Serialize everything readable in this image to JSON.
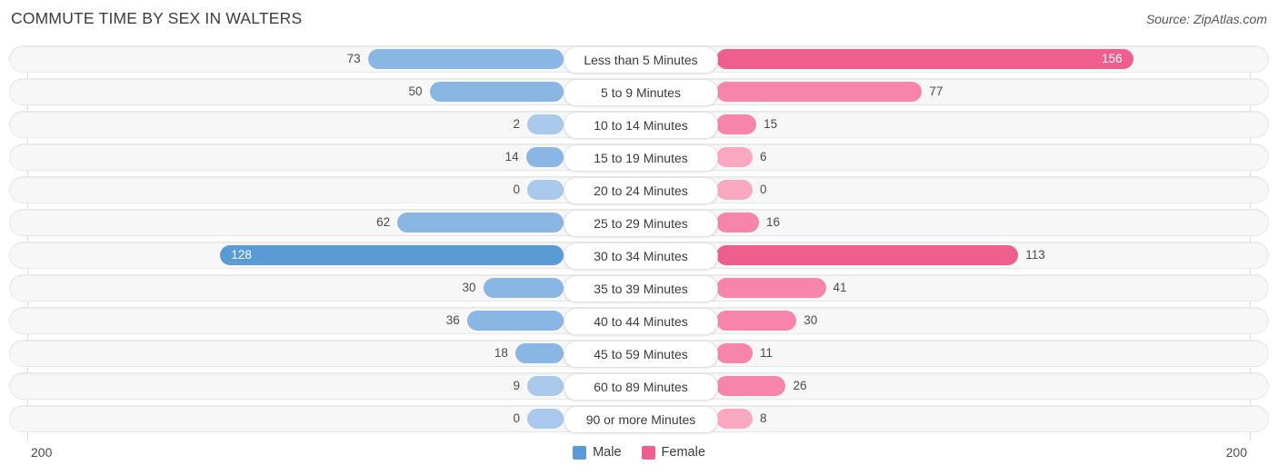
{
  "header": {
    "title": "COMMUTE TIME BY SEX IN WALTERS",
    "source": "Source: ZipAtlas.com"
  },
  "axis": {
    "left_tick": "200",
    "right_tick": "200"
  },
  "legend": {
    "items": [
      {
        "label": "Male",
        "color": "#5b9bd5"
      },
      {
        "label": "Female",
        "color": "#ef5f8d"
      }
    ]
  },
  "colors": {
    "male_strong": "#5b9bd5",
    "male_light": "#a8c8ec",
    "female_strong": "#ef5f8d",
    "female_light": "#f9a8c0",
    "track": "#f7f7f7",
    "track_border": "#e8e8e8",
    "axis_line": "#dcdcdc"
  },
  "chart_data": {
    "type": "bar",
    "title": "COMMUTE TIME BY SEX IN WALTERS",
    "orientation": "horizontal-diverging",
    "xlabel": "",
    "ylabel": "",
    "xlim": [
      -200,
      200
    ],
    "axis_max": 200,
    "grid": false,
    "legend_position": "bottom-center",
    "categories": [
      "Less than 5 Minutes",
      "5 to 9 Minutes",
      "10 to 14 Minutes",
      "15 to 19 Minutes",
      "20 to 24 Minutes",
      "25 to 29 Minutes",
      "30 to 34 Minutes",
      "35 to 39 Minutes",
      "40 to 44 Minutes",
      "45 to 59 Minutes",
      "60 to 89 Minutes",
      "90 or more Minutes"
    ],
    "series": [
      {
        "name": "Male",
        "color": "#5b9bd5",
        "values": [
          73,
          50,
          2,
          14,
          0,
          62,
          128,
          30,
          36,
          18,
          9,
          0
        ]
      },
      {
        "name": "Female",
        "color": "#ef5f8d",
        "values": [
          156,
          77,
          15,
          6,
          0,
          16,
          113,
          41,
          30,
          11,
          26,
          8
        ]
      }
    ]
  },
  "rows": [
    {
      "label": "Less than 5 Minutes",
      "male": "73",
      "female": "156"
    },
    {
      "label": "5 to 9 Minutes",
      "male": "50",
      "female": "77"
    },
    {
      "label": "10 to 14 Minutes",
      "male": "2",
      "female": "15"
    },
    {
      "label": "15 to 19 Minutes",
      "male": "14",
      "female": "6"
    },
    {
      "label": "20 to 24 Minutes",
      "male": "0",
      "female": "0"
    },
    {
      "label": "25 to 29 Minutes",
      "male": "62",
      "female": "16"
    },
    {
      "label": "30 to 34 Minutes",
      "male": "128",
      "female": "113"
    },
    {
      "label": "35 to 39 Minutes",
      "male": "30",
      "female": "41"
    },
    {
      "label": "40 to 44 Minutes",
      "male": "36",
      "female": "30"
    },
    {
      "label": "45 to 59 Minutes",
      "male": "18",
      "female": "11"
    },
    {
      "label": "60 to 89 Minutes",
      "male": "9",
      "female": "26"
    },
    {
      "label": "90 or more Minutes",
      "male": "0",
      "female": "8"
    }
  ]
}
